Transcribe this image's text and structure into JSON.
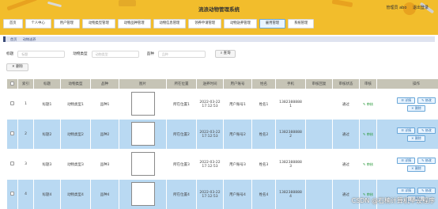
{
  "header": {
    "title": "流浪动物管理系统",
    "user_label": "管理员 abo",
    "logout_label": "退出登录",
    "bg_color": "#f2bd2c"
  },
  "nav": {
    "items": [
      "首页",
      "个人中心",
      "用户管理",
      "动物类型管理",
      "动物品种管理",
      "动物信息管理",
      "领养申请管理",
      "动物送养管理",
      "雇用管理",
      "系统管理"
    ],
    "active_index": 8
  },
  "breadcrumb": {
    "home": "首页",
    "current": "动物送养"
  },
  "filters": {
    "title_label": "标题",
    "title_placeholder": "标题",
    "type_label": "动物类型",
    "type_placeholder": "动物类型",
    "breed_label": "品种",
    "breed_placeholder": "品种",
    "search_label": "查询"
  },
  "toolbar": {
    "delete_label": "删除"
  },
  "table": {
    "headers": [
      "",
      "索引",
      "标题",
      "动物类型",
      "品种",
      "图片",
      "所在位置",
      "送养时间",
      "用户账号",
      "姓名",
      "手机",
      "审核回复",
      "审核状态",
      "审核",
      "操作"
    ],
    "review_link_label": "审核",
    "action_labels": {
      "detail": "详情",
      "edit": "修改",
      "delete": "删除"
    },
    "rows": [
      {
        "index": "1",
        "title": "标题1",
        "type": "动物类型1",
        "breed": "品种1",
        "location": "所在位置1",
        "date": "2022-03-22",
        "time": "17:12:53",
        "account": "用户账号1",
        "name": "姓名1",
        "phone1": "1382388888",
        "phone2": "1",
        "reply": "",
        "status": "通过"
      },
      {
        "index": "2",
        "title": "标题2",
        "type": "动物类型2",
        "breed": "品种2",
        "location": "所在位置2",
        "date": "2022-03-22",
        "time": "17:12:53",
        "account": "用户账号2",
        "name": "姓名2",
        "phone1": "1382388888",
        "phone2": "2",
        "reply": "",
        "status": "通过"
      },
      {
        "index": "3",
        "title": "标题3",
        "type": "动物类型3",
        "breed": "品种3",
        "location": "所在位置3",
        "date": "2022-03-22",
        "time": "17:12:53",
        "account": "用户账号3",
        "name": "姓名3",
        "phone1": "1382388888",
        "phone2": "3",
        "reply": "",
        "status": "通过"
      },
      {
        "index": "4",
        "title": "标题4",
        "type": "动物类型4",
        "breed": "品种4",
        "location": "所在位置4",
        "date": "2022-03-22",
        "time": "17:12:53",
        "account": "用户账号4",
        "name": "姓名4",
        "phone1": "1382388888",
        "phone2": "4",
        "reply": "",
        "status": "通过"
      }
    ]
  },
  "watermark": "CSDN @石楠计算机毕设程序"
}
